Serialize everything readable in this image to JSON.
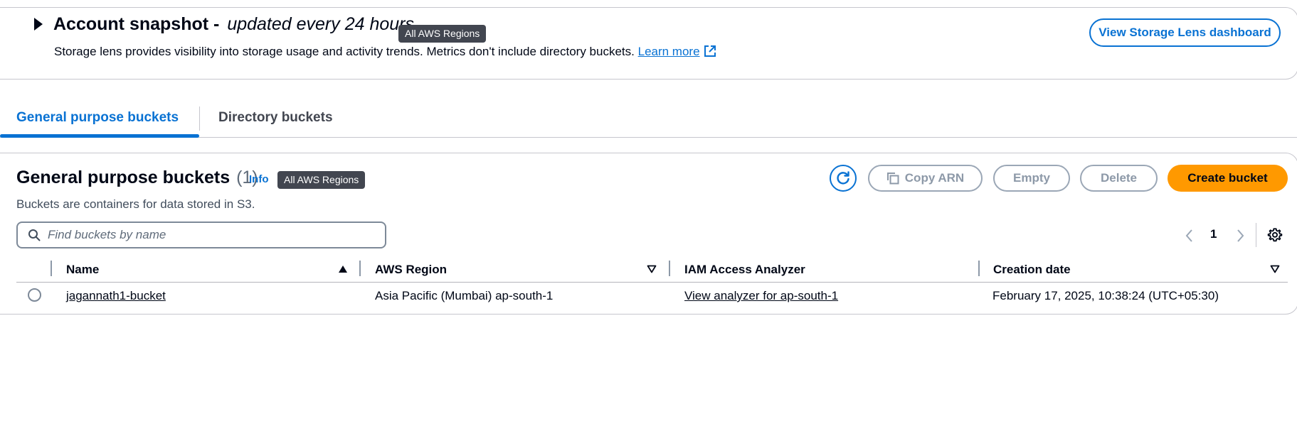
{
  "snapshot": {
    "title": "Account snapshot",
    "separator": " -",
    "subtitle": "updated every 24 hours",
    "badge": "All AWS Regions",
    "description": "Storage lens provides visibility into storage usage and activity trends. Metrics don't include directory buckets.",
    "learn_more": "Learn more",
    "dashboard_button": "View Storage Lens dashboard"
  },
  "tabs": [
    {
      "label": "General purpose buckets",
      "active": true
    },
    {
      "label": "Directory buckets",
      "active": false
    }
  ],
  "panel": {
    "title": "General purpose buckets",
    "count": "(1)",
    "info": "Info",
    "badge": "All AWS Regions",
    "description": "Buckets are containers for data stored in S3."
  },
  "actions": {
    "copy_arn": "Copy ARN",
    "empty": "Empty",
    "delete": "Delete",
    "create": "Create bucket"
  },
  "search": {
    "placeholder": "Find buckets by name",
    "value": ""
  },
  "pagination": {
    "current_page": "1"
  },
  "table": {
    "columns": [
      "Name",
      "AWS Region",
      "IAM Access Analyzer",
      "Creation date"
    ],
    "rows": [
      {
        "name": "jagannath1-bucket",
        "region": "Asia Pacific (Mumbai) ap-south-1",
        "analyzer": "View analyzer for ap-south-1",
        "created": "February 17, 2025, 10:38:24 (UTC+05:30)",
        "selected": false
      }
    ]
  },
  "colors": {
    "accent": "#0972d3",
    "primary_button": "#ff9900",
    "badge_bg": "#424650",
    "disabled": "#8d99a8"
  }
}
